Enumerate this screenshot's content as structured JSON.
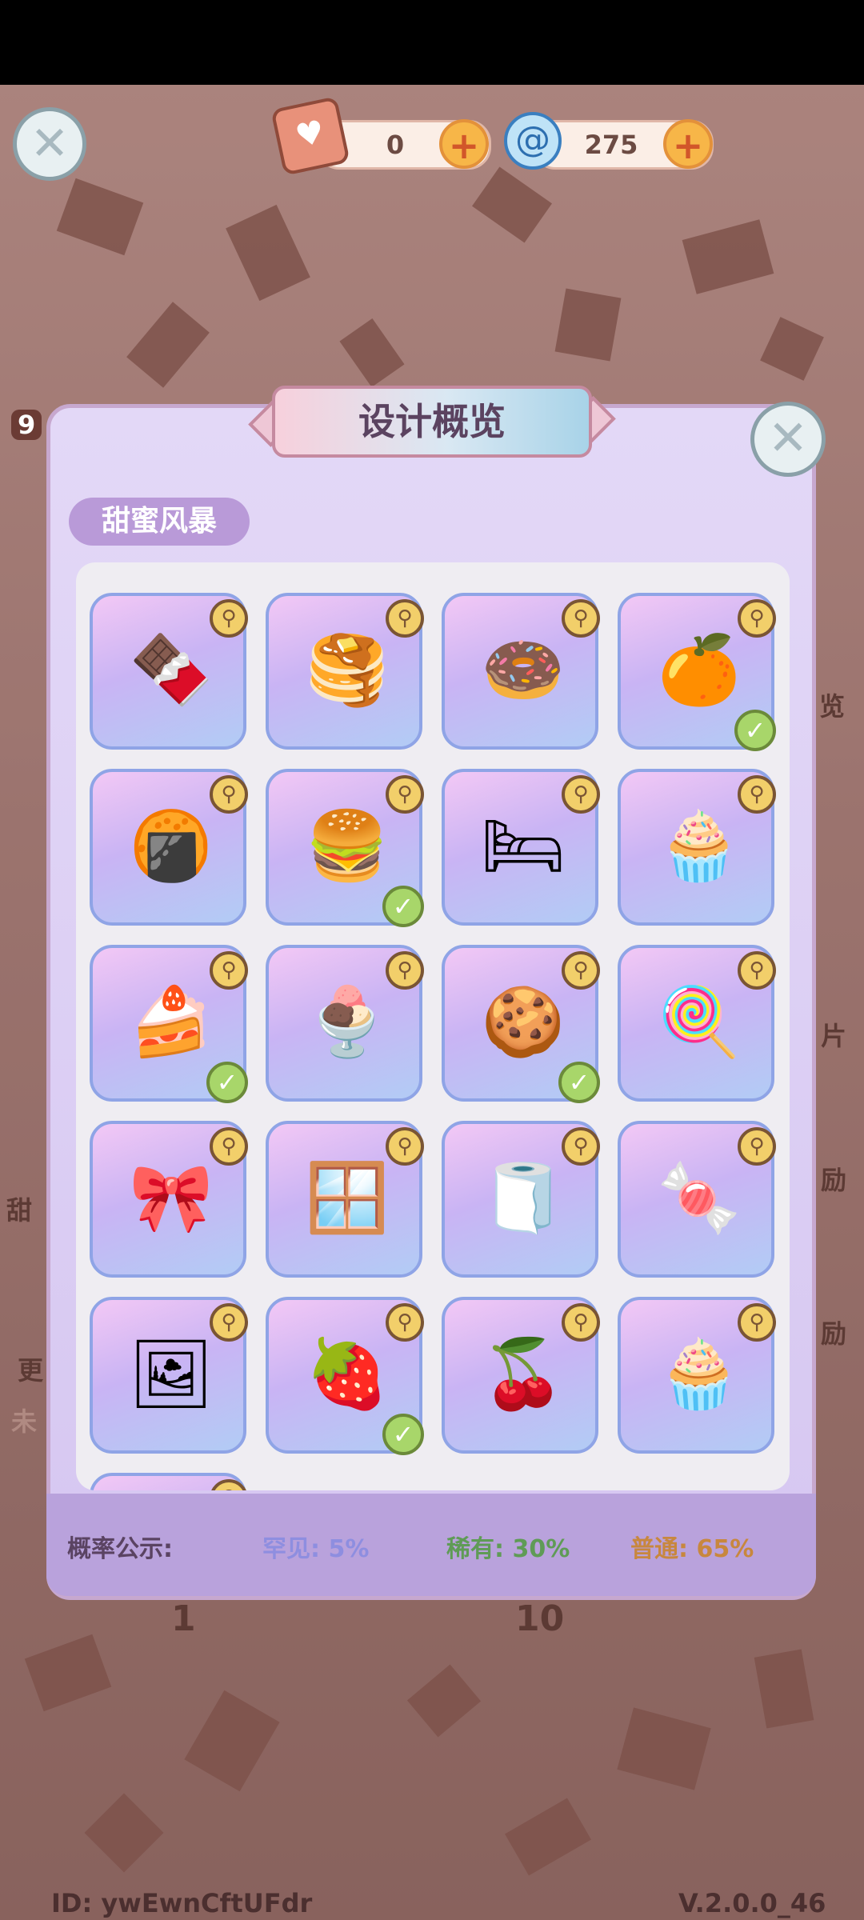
{
  "header": {
    "tickets": {
      "value": "0",
      "icon": "ticket-box-icon"
    },
    "candy": {
      "value": "275",
      "icon": "swirl-candy-icon"
    }
  },
  "modal": {
    "title": "设计概览",
    "subtitle": "甜蜜风暴",
    "items": [
      {
        "name": "chocolate-lattice-decor",
        "icon": "🍫",
        "owned": false
      },
      {
        "name": "macaron-stack",
        "icon": "🥞",
        "owned": false
      },
      {
        "name": "pink-bean-bag-chair",
        "icon": "🍩",
        "owned": false
      },
      {
        "name": "orange-slice-sofa",
        "icon": "🍊",
        "owned": true
      },
      {
        "name": "macaron-ottoman",
        "icon": "🍘",
        "owned": false
      },
      {
        "name": "matcha-macaron",
        "icon": "🍔",
        "owned": true
      },
      {
        "name": "cake-bed",
        "icon": "🛏",
        "owned": false
      },
      {
        "name": "red-velvet-cube",
        "icon": "🧁",
        "owned": false
      },
      {
        "name": "layer-cake-cube",
        "icon": "🍰",
        "owned": true
      },
      {
        "name": "berry-parfait",
        "icon": "🍨",
        "owned": false
      },
      {
        "name": "cookie-rug",
        "icon": "🍪",
        "owned": true
      },
      {
        "name": "lollipop-lamp",
        "icon": "🍭",
        "owned": false
      },
      {
        "name": "lace-heart-garland",
        "icon": "🎀",
        "owned": false
      },
      {
        "name": "chocolate-window",
        "icon": "🪟",
        "owned": false
      },
      {
        "name": "sprinkle-rug",
        "icon": "🧻",
        "owned": false
      },
      {
        "name": "striped-candy",
        "icon": "🍬",
        "owned": false
      },
      {
        "name": "picture-frame",
        "icon": "🖼",
        "owned": false
      },
      {
        "name": "strawberry-candy",
        "icon": "🍓",
        "owned": true
      },
      {
        "name": "cherry-sundae",
        "icon": "🍒",
        "owned": false
      },
      {
        "name": "cupcake-tower",
        "icon": "🧁",
        "owned": false
      }
    ],
    "probability": {
      "label": "概率公示:",
      "rare": "罕见: 5%",
      "uncommon": "稀有: 30%",
      "common": "普通: 65%",
      "colors": {
        "rare": "#8e8ee0",
        "uncommon": "#5f9b56",
        "common": "#c8873e"
      }
    }
  },
  "footer": {
    "id": "ID: ywEwnCftUFdr",
    "version": "V.2.0.0_46"
  },
  "background": {
    "fragments": [
      "9",
      "甜",
      "更",
      "未",
      "览",
      "片",
      "励",
      "励",
      "1",
      "10"
    ]
  }
}
